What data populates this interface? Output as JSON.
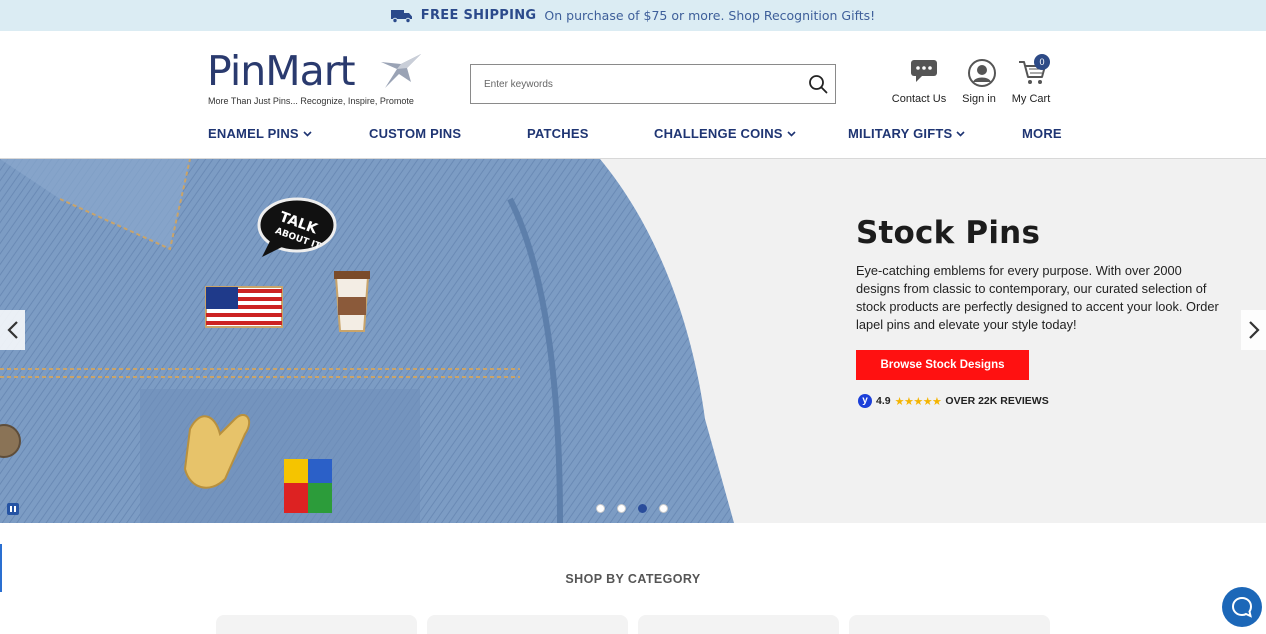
{
  "promo": {
    "strong": "FREE SHIPPING",
    "text": "On purchase of $75 or more. Shop Recognition Gifts!"
  },
  "header": {
    "logo_word": "PinMart",
    "logo_tagline": "More Than Just Pins... Recognize, Inspire, Promote",
    "search_placeholder": "Enter keywords",
    "contact_label": "Contact Us",
    "signin_label": "Sign in",
    "cart_label": "My Cart",
    "cart_count": "0"
  },
  "nav": {
    "items": [
      {
        "label": "ENAMEL PINS",
        "dropdown": true
      },
      {
        "label": "CUSTOM PINS",
        "dropdown": false
      },
      {
        "label": "PATCHES",
        "dropdown": false
      },
      {
        "label": "CHALLENGE COINS",
        "dropdown": true
      },
      {
        "label": "MILITARY GIFTS",
        "dropdown": true
      },
      {
        "label": "MORE",
        "dropdown": false
      }
    ]
  },
  "hero": {
    "title": "Stock Pins",
    "description": "Eye-catching emblems for every purpose. With over 2000 designs from classic to contemporary, our curated selection of stock products are perfectly designed to accent your look. Order lapel pins and elevate your style today!",
    "button_label": "Browse Stock Designs",
    "rating_value": "4.9",
    "rating_stars": "★★★★★",
    "reviews_text": "OVER 22K REVIEWS",
    "slide_count": 4,
    "active_slide": 3
  },
  "categories": {
    "title": "SHOP BY CATEGORY"
  },
  "colors": {
    "brand_navy": "#1f3573",
    "cta_red": "#ff1111",
    "promo_bg": "#dbecf3",
    "chat_blue": "#1c67b8"
  }
}
